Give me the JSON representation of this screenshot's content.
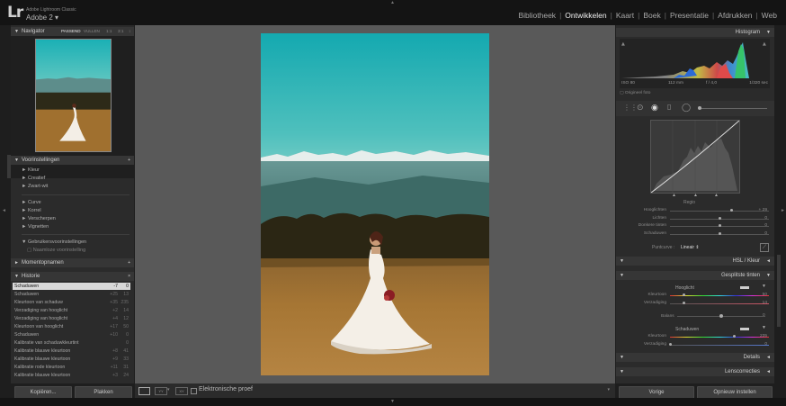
{
  "app": {
    "logo": "Lr",
    "name": "Adobe Lightroom Classic",
    "catalog": "Adobe 2"
  },
  "modules": [
    "Bibliotheek",
    "Ontwikkelen",
    "Kaart",
    "Boek",
    "Presentatie",
    "Afdrukken",
    "Web"
  ],
  "active_module": "Ontwikkelen",
  "navigator": {
    "title": "Navigator",
    "zoom_options": [
      "PASSEND",
      "VULLEN",
      "1:1",
      "3:1"
    ],
    "zoom_more": "↕"
  },
  "presets": {
    "title": "Voorinstellingen",
    "items": [
      "Kleur",
      "Creatief",
      "Zwart-wit",
      "Curve",
      "Korrel",
      "Verscherpen",
      "Vignetten",
      "Gebruikersvoorinstellingen",
      "Naamloze voorinstelling"
    ]
  },
  "snapshots": {
    "title": "Momentopnamen"
  },
  "history": {
    "title": "Historie",
    "items": [
      {
        "label": "Schaduwen",
        "v1": "-7",
        "v2": "0"
      },
      {
        "label": "Schaduwen",
        "v1": "+25",
        "v2": "13"
      },
      {
        "label": "Kleurtoon van schaduw",
        "v1": "+35",
        "v2": "235"
      },
      {
        "label": "Verzadiging van hooglicht",
        "v1": "+2",
        "v2": "14"
      },
      {
        "label": "Verzadiging van hooglicht",
        "v1": "+4",
        "v2": "12"
      },
      {
        "label": "Kleurtoon van hooglicht",
        "v1": "+17",
        "v2": "50"
      },
      {
        "label": "Schaduwen",
        "v1": "+10",
        "v2": "0"
      },
      {
        "label": "Kalibratie van schaduwkleurtint",
        "v1": "",
        "v2": "0"
      },
      {
        "label": "Kalibratie blauwe kleurtoon",
        "v1": "+8",
        "v2": "41"
      },
      {
        "label": "Kalibratie blauwe kleurtoon",
        "v1": "+9",
        "v2": "33"
      },
      {
        "label": "Kalibratie rode kleurtoon",
        "v1": "+11",
        "v2": "31"
      },
      {
        "label": "Kalibratie blauwe kleurtoon",
        "v1": "+3",
        "v2": "24"
      }
    ]
  },
  "left_buttons": {
    "copy": "Kopiëren...",
    "paste": "Plakken"
  },
  "toolbar": {
    "soft_proof": "Elektronische proef",
    "view_icons": [
      "YY",
      "XY"
    ]
  },
  "histogram": {
    "title": "Histogram",
    "info": [
      "ISO 80",
      "112 mm",
      "f / 4,0",
      "1/320 sec"
    ],
    "original_photo": "Origineel foto"
  },
  "tone_curve": {
    "region_title": "Regio",
    "sliders": [
      {
        "label": "Hooglichten",
        "value": "+ 29",
        "pos": 0.62
      },
      {
        "label": "Lichten",
        "value": "0",
        "pos": 0.5
      },
      {
        "label": "Donkere tinten",
        "value": "0",
        "pos": 0.5
      },
      {
        "label": "Schaduwen",
        "value": "0",
        "pos": 0.5
      }
    ],
    "point_curve_label": "Puntcurve :",
    "point_curve_value": "Lineair"
  },
  "hsl": {
    "title": "HSL / Kleur"
  },
  "split_toning": {
    "title": "Gesplitste tinten",
    "highlights_title": "Hooglicht",
    "balance_label": "Balans",
    "shadows_title": "Schaduwen",
    "highlights": [
      {
        "label": "Kleurtoon",
        "value": "50",
        "pos": 0.14
      },
      {
        "label": "Verzadiging",
        "value": "14",
        "pos": 0.14
      }
    ],
    "balance": {
      "value": "0",
      "pos": 0.5
    },
    "shadows": [
      {
        "label": "Kleurtoon",
        "value": "235",
        "pos": 0.65
      },
      {
        "label": "Verzadiging",
        "value": "0",
        "pos": 0.0
      }
    ]
  },
  "details": {
    "title": "Details"
  },
  "lens_corrections": {
    "title": "Lenscorrecties"
  },
  "right_buttons": {
    "previous": "Vorige",
    "reset": "Opnieuw instellen"
  },
  "colors": {
    "accent": "#e8e8e8",
    "panel": "#2b2b2b",
    "center": "#595959"
  }
}
